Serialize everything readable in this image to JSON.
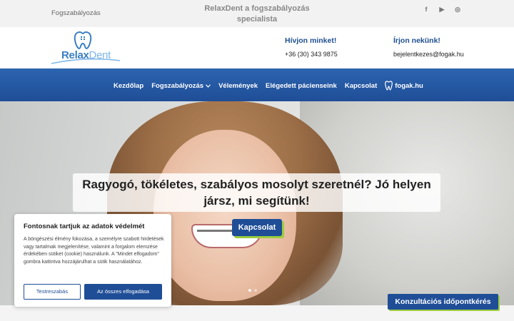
{
  "topbar": {
    "left_text": "Fogszabályozás",
    "center_text": "RelaxDent a fogszabályozás specialista",
    "socials": [
      {
        "icon": "facebook-icon",
        "glyph": "f"
      },
      {
        "icon": "youtube-icon",
        "glyph": "▶"
      },
      {
        "icon": "instagram-icon",
        "glyph": "◎"
      }
    ]
  },
  "header": {
    "logo_main": "Relax",
    "logo_accent": "Dent",
    "phone_label": "Hívjon minket!",
    "phone_value": "+36 (30) 343 9875",
    "email_label": "Írjon nekünk!",
    "email_value": "bejelentkezes@fogak.hu"
  },
  "nav": {
    "items": [
      {
        "label": "Kezdőlap"
      },
      {
        "label": "Fogszabályozás",
        "has_dropdown": true
      },
      {
        "label": "Vélemények"
      },
      {
        "label": "Elégedett pácienseink"
      },
      {
        "label": "Kapcsolat"
      },
      {
        "label": "fogak.hu",
        "icon": "tooth-icon"
      }
    ]
  },
  "hero": {
    "title": "Ragyogó, tökéletes, szabályos mosolyt szeretnél? Jó helyen jársz, mi segítünk!",
    "button_label": "Kapcsolat",
    "slide_count": 2,
    "active_slide": 0
  },
  "cookie": {
    "title": "Fontosnak tartjuk az adatok védelmét",
    "body": "A böngészési élmény fokozása, a személyre szabott hirdetések vagy tartalmak megjelenítése, valamint a forgalom elemzése érdekében sütiket (cookie) használunk. A \"Mindet elfogadom\" gombra kattintva hozzájárulhat a sütik használatához.",
    "customize_label": "Testreszabás",
    "accept_label": "Az összes elfogadása"
  },
  "consult_button": "Konzultációs időpontkérés",
  "colors": {
    "brand_blue": "#1f4e97",
    "accent_green": "#9ccc3f"
  }
}
